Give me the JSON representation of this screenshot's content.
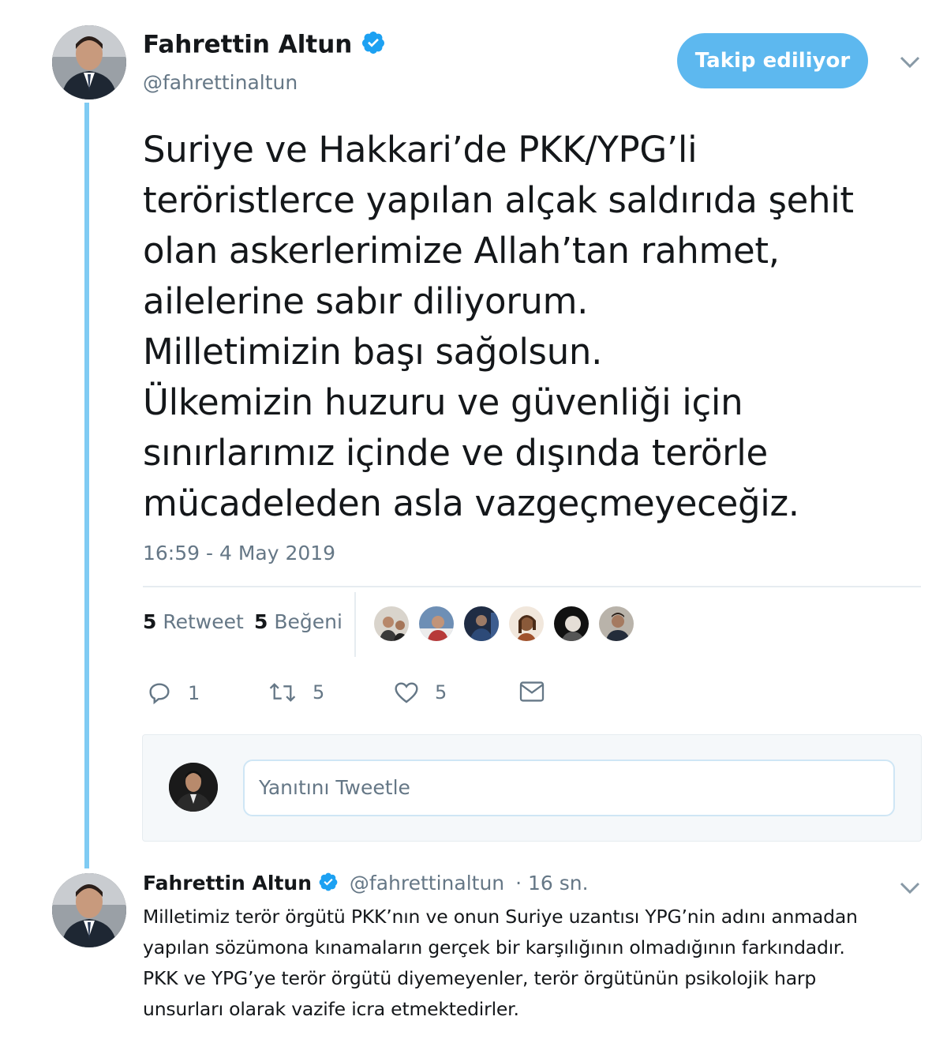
{
  "tweet": {
    "author_name": "Fahrettin Altun",
    "author_handle": "@fahrettinaltun",
    "follow_label": "Takip ediliyor",
    "text": "Suriye ve Hakkari’de PKK/YPG’li\nteröristlerce yapılan alçak saldırıda şehit\nolan askerlerimize Allah’tan rahmet,\nailelerine sabır diliyorum.\nMilletimizin başı sağolsun.\nÜlkemizin huzuru ve güvenliği için\nsınırlarımız içinde ve dışında terörle\nmücadeleden asla vazgeçmeyeceğiz.",
    "timestamp": "16:59 - 4 May 2019",
    "retweet_count": "5",
    "retweet_label": "Retweet",
    "like_count": "5",
    "like_label": "Beğeni",
    "likers_count": 6
  },
  "actions": {
    "reply_count": "1",
    "retweet_count": "5",
    "like_count": "5"
  },
  "reply_box": {
    "placeholder": "Yanıtını Tweetle"
  },
  "reply": {
    "author_name": "Fahrettin Altun",
    "author_handle": "@fahrettinaltun",
    "time": "· 16 sn.",
    "text": "Milletimiz terör örgütü PKK’nın ve onun Suriye uzantısı YPG’nin adını anmadan\nyapılan sözümona kınamaların gerçek bir karşılığının olmadığının farkındadır.\nPKK ve YPG’ye terör örgütü diyemeyenler, terör örgütünün psikolojik harp\nunsurları olarak vazife icra etmektedirler."
  },
  "colors": {
    "accent": "#1da1f2",
    "follow_button": "#5db8ef",
    "thread_line": "#7fcbf3",
    "secondary_text": "#657786"
  },
  "icons": [
    "verified-badge-icon",
    "chevron-down-icon",
    "reply-icon",
    "retweet-icon",
    "like-icon",
    "direct-message-icon"
  ]
}
